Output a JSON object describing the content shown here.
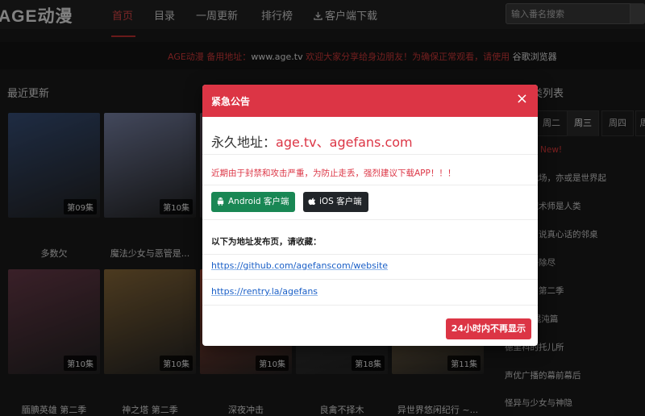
{
  "nav": {
    "logo": "AGE动漫",
    "items": [
      "首页",
      "目录",
      "一周更新",
      "排行榜",
      "客户端下载"
    ],
    "search_placeholder": "输入番名搜索"
  },
  "notice": {
    "part1": "AGE动漫 备用地址：",
    "domain": "www.age.tv",
    "part2": " 欢迎大家分享给身边朋友！为确保正常观看，请使用 ",
    "browser": "谷歌浏览器"
  },
  "recent": {
    "title": "最近更新",
    "cards": [
      {
        "title": "多数欠",
        "ep": "第09集",
        "color": "#38507a"
      },
      {
        "title": "魔法少女与恶管是...",
        "ep": "第10集",
        "color": "#7a84a8"
      },
      {
        "title": "",
        "ep": "",
        "color": "#6b5a6a"
      },
      {
        "title": "",
        "ep": "",
        "color": "#4a4a52"
      },
      {
        "title": "",
        "ep": "",
        "color": "#5d5030"
      },
      {
        "title": "腼腆英雄 第二季",
        "ep": "第10集",
        "color": "#6a3b4a"
      },
      {
        "title": "神之塔 第二季",
        "ep": "第10集",
        "color": "#8a6a3a"
      },
      {
        "title": "深夜冲击",
        "ep": "第10集",
        "color": "#b8503a"
      },
      {
        "title": "良禽不择木",
        "ep": "第18集",
        "color": "#3a3a3a"
      },
      {
        "title": "异世界悠闲纪行 ~...",
        "ep": "第11集",
        "color": "#a88a5a"
      }
    ]
  },
  "sidebar": {
    "title": "类列表",
    "tabs": [
      "周二",
      "周三",
      "周四",
      "周"
    ],
    "active_tab": "周三",
    "new_label": "New!",
    "items": [
      "最后的战场，亦或是世界起",
      "最强的魔术师是人类",
      "我语小声说真心话的邻桌",
      "法用双子除尽",
      "的孩子】第二季",
      "【 千魔混沌篇",
      "德里科的托儿所",
      "声优广播的幕前幕后",
      "怪异与少女与神隐"
    ]
  },
  "modal": {
    "title": "紧急公告",
    "close": "×",
    "addr_label": "永久地址：",
    "addr_value": "age.tv、agefans.com",
    "warning": "近期由于封禁和攻击严重，为防止走丢，强烈建议下载APP！！！",
    "android_label": "Android 客户端",
    "ios_label": "iOS 客户端",
    "bookmark_text": "以下为地址发布页，请收藏：",
    "links": [
      "https://github.com/agefanscom/website",
      "https://rentry.la/agefans"
    ],
    "dismiss": "24小时内不再显示"
  },
  "colors": {
    "accent": "#dc3545",
    "android": "#198754",
    "ios": "#212529",
    "link": "#1a5fc7"
  }
}
